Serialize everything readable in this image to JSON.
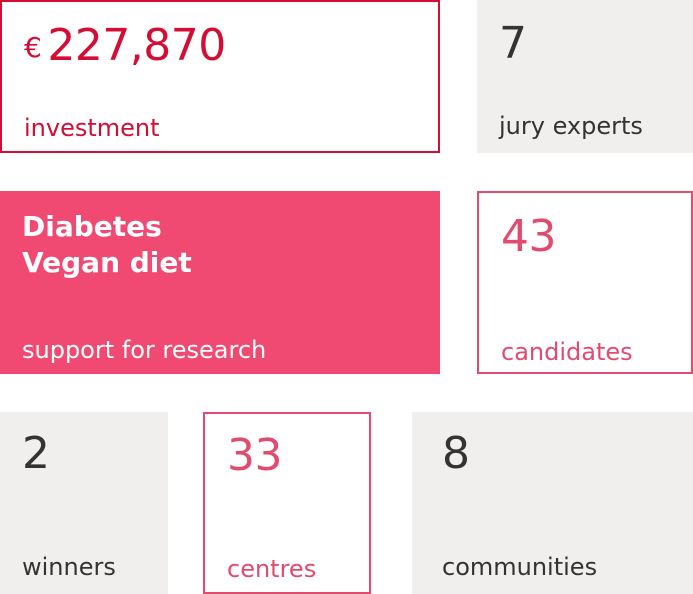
{
  "stats": {
    "investment": {
      "currency": "€",
      "value": "227,870",
      "label": "investment"
    },
    "jury": {
      "value": "7",
      "label": "jury experts"
    },
    "focus": {
      "lines": [
        "Diabetes",
        "Vegan diet"
      ],
      "label": "support for research"
    },
    "candidates": {
      "value": "43",
      "label": "candidates"
    },
    "winners": {
      "value": "2",
      "label": "winners"
    },
    "centres": {
      "value": "33",
      "label": "centres"
    },
    "communities": {
      "value": "8",
      "label": "communities"
    }
  },
  "colors": {
    "red": "#d40d34",
    "pink": "#e34a6f",
    "pink_fill": "#f04a72",
    "gray": "#f0efed",
    "text_dark": "#333333"
  }
}
